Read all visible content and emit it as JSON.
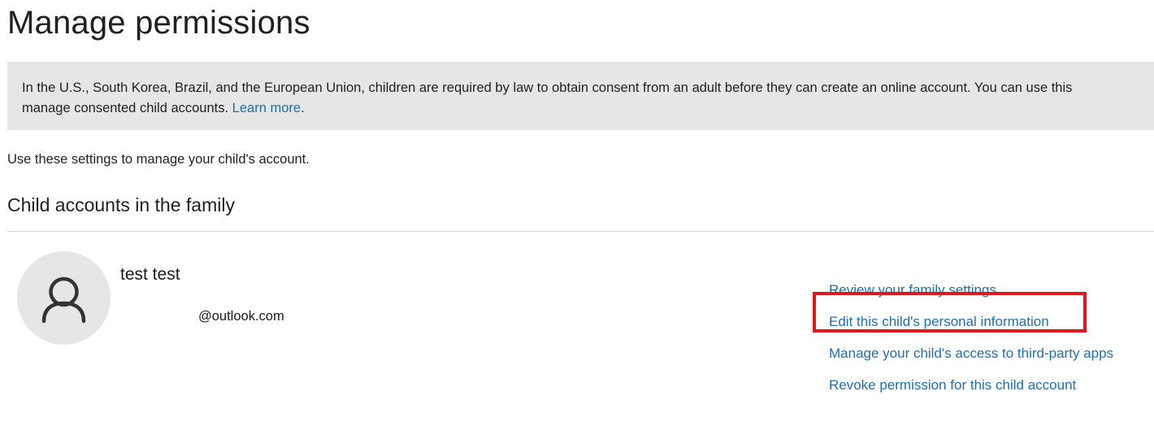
{
  "page": {
    "title": "Manage permissions"
  },
  "notice": {
    "line1": "In the U.S., South Korea, Brazil, and the European Union, children are required by law to obtain consent from an adult before they can create an online account. You can use this",
    "line2_prefix": "manage consented child accounts. ",
    "learn_more": "Learn more",
    "line2_suffix": "."
  },
  "intro": "Use these settings to manage your child's account.",
  "section": {
    "heading": "Child accounts in the family"
  },
  "child": {
    "avatar_icon": "person-icon",
    "name": "test test",
    "email_visible": "@outlook.com"
  },
  "actions": [
    {
      "label": "Review your family settings"
    },
    {
      "label": "Edit this child's personal information"
    },
    {
      "label": "Manage your child's access to third-party apps"
    },
    {
      "label": "Revoke permission for this child account"
    }
  ],
  "colors": {
    "link": "#1e6fb0",
    "notice_bg": "#e6e6e6",
    "highlight": "#e0181b"
  }
}
